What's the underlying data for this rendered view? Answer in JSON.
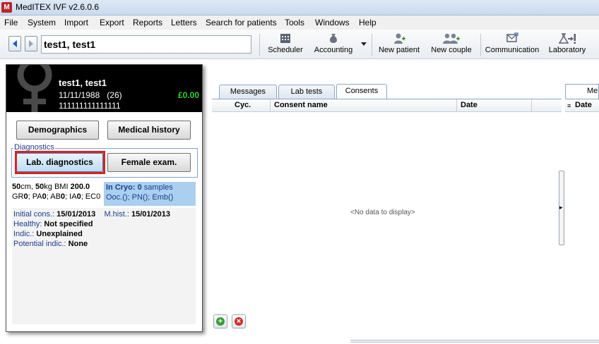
{
  "window": {
    "title": "MedITEX IVF v2.6.0.6",
    "app_icon": "meditex-logo-icon"
  },
  "menu": {
    "items": [
      {
        "label": "File"
      },
      {
        "label": "System"
      },
      {
        "label": "Import"
      },
      {
        "label": "Export"
      },
      {
        "label": "Reports"
      },
      {
        "label": "Letters"
      },
      {
        "label": "Search for patients"
      },
      {
        "label": "Tools"
      },
      {
        "label": "Windows"
      },
      {
        "label": "Help"
      }
    ]
  },
  "toolbar": {
    "patient_field_value": "test1, test1",
    "buttons": [
      {
        "label": "Scheduler",
        "icon": "calendar-grid-icon"
      },
      {
        "label": "Accounting",
        "icon": "money-bag-icon"
      },
      {
        "label": "New patient",
        "icon": "person-add-icon"
      },
      {
        "label": "New couple",
        "icon": "couple-add-icon"
      },
      {
        "label": "Communication",
        "icon": "communication-icon"
      },
      {
        "label": "Laboratory",
        "icon": "flask-alert-icon"
      }
    ]
  },
  "patient_card": {
    "name": "test1, test1",
    "dob": "11/11/1988",
    "age": "(26)",
    "patient_id": "111111111111111",
    "balance": "£0.00",
    "buttons": {
      "demographics": "Demographics",
      "medical_history": "Medical history",
      "lab_diagnostics": "Lab. diagnostics",
      "female_exam": "Female exam."
    },
    "diagnostics_legend": "Diagnostics",
    "metrics": {
      "height_value": "50",
      "height_unit": "cm, ",
      "weight_value": "50",
      "weight_unit": "kg BMI ",
      "bmi_value": "200.0",
      "gr_label": "GR",
      "gr_value": "0",
      "pa_label": "; PA",
      "pa_value": "0",
      "ab_label": "; AB",
      "ab_value": "0",
      "ia_label": "; IA",
      "ia_value": "0",
      "ec_label": "; EC0"
    },
    "cryo": {
      "label": "In Cryo: 0",
      "suffix": " samples",
      "detail": "Ooc.(); PN(); Emb()"
    },
    "info": {
      "initial_cons_label": "Initial cons.:",
      "initial_cons_value": "15/01/2013",
      "mhist_label": "M.hist.:",
      "mhist_value": "15/01/2013",
      "healthy_label": "Healthy:",
      "healthy_value": "Not specified",
      "indic_label": "Indic.:",
      "indic_value": "Unexplained",
      "potential_label": "Potential indic.:",
      "potential_value": "None"
    }
  },
  "tabs": [
    {
      "label": "Messages"
    },
    {
      "label": "Lab tests"
    },
    {
      "label": "Consents"
    }
  ],
  "grid": {
    "columns": [
      "Cyc.",
      "Consent name",
      "Date"
    ],
    "empty_text": "<No data to display>"
  },
  "right_panel": {
    "tab_label": "Me",
    "column": "Date"
  },
  "colors": {
    "balance": "#2fd32f",
    "highlight": "#e02020",
    "cryo_bg": "#aacfef"
  }
}
